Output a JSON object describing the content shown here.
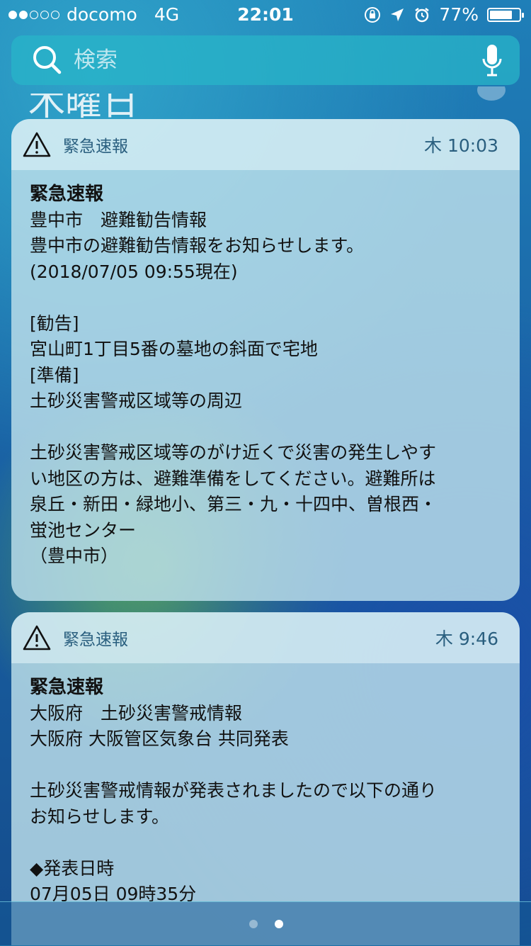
{
  "status_bar": {
    "carrier": "docomo",
    "network": "4G",
    "time": "22:01",
    "battery_percent": "77%",
    "battery_level": 0.77
  },
  "search": {
    "placeholder": "検索"
  },
  "date_header": "木曜日",
  "notifications": [
    {
      "app_name": "緊急速報",
      "time": "木 10:03",
      "title": "緊急速報",
      "lines": [
        "豊中市　避難勧告情報",
        "豊中市の避難勧告情報をお知らせします。",
        "(2018/07/05 09:55現在)",
        "",
        "[勧告]",
        "宮山町1丁目5番の墓地の斜面で宅地",
        "[準備]",
        "土砂災害警戒区域等の周辺",
        "",
        "土砂災害警戒区域等のがけ近くで災害の発生しやす",
        "い地区の方は、避難準備をしてください。避難所は",
        "泉丘・新田・緑地小、第三・九・十四中、曽根西・",
        "蛍池センター",
        "（豊中市）"
      ]
    },
    {
      "app_name": "緊急速報",
      "time": "木 9:46",
      "title": "緊急速報",
      "lines": [
        "大阪府　土砂災害警戒情報",
        "大阪府 大阪管区気象台 共同発表",
        "",
        "土砂災害警戒情報が発表されましたので以下の通り",
        "お知らせします。",
        "",
        "◆発表日時",
        "07月05日 09時35分"
      ]
    }
  ],
  "page_indicator": {
    "count": 2,
    "active": 1
  },
  "colors": {
    "accent_text": "#2a5f7f",
    "search_bg": "#28b4c8"
  }
}
